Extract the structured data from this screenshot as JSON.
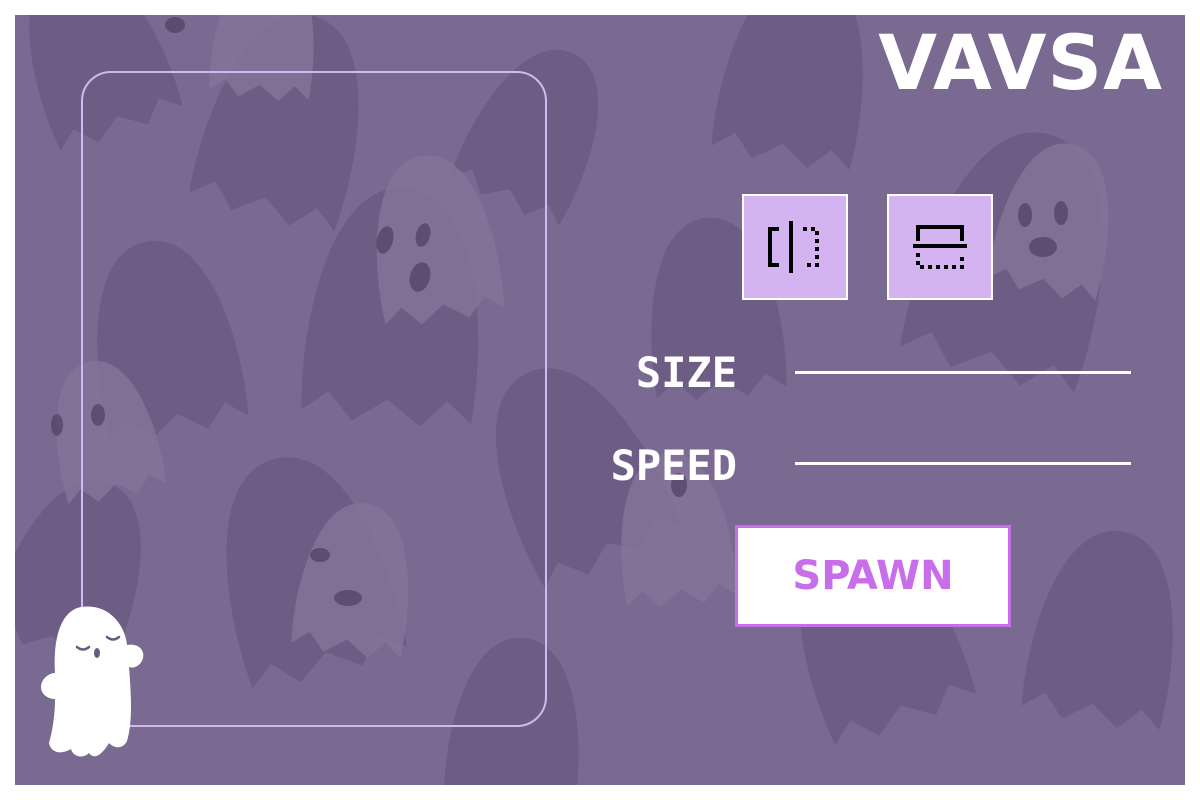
{
  "app": {
    "title": "VAVSA"
  },
  "toolbar": {
    "flip_vertical_icon": "flip-vertical-icon",
    "flip_horizontal_icon": "flip-horizontal-icon"
  },
  "controls": {
    "size": {
      "label": "SIZE",
      "value": null
    },
    "speed": {
      "label": "SPEED",
      "value": null
    }
  },
  "actions": {
    "spawn_label": "SPAWN"
  },
  "colors": {
    "background": "#7a6991",
    "panel_border": "#d4b6f0",
    "tool_button": "#d4b3f1",
    "accent": "#c86eea",
    "text": "#ffffff"
  }
}
